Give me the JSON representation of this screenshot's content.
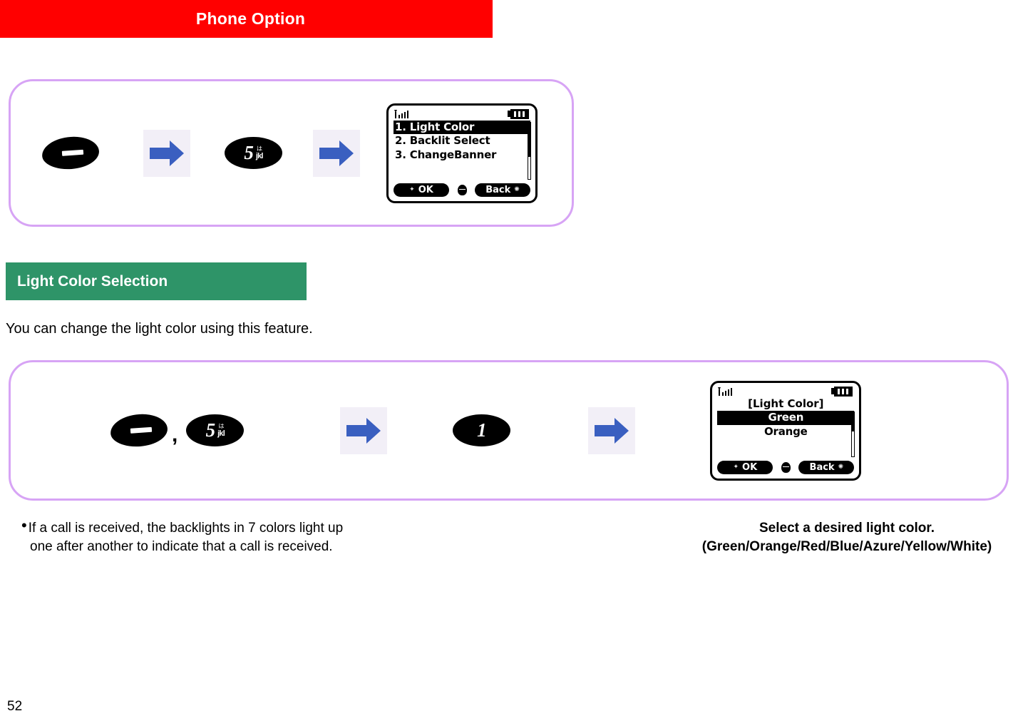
{
  "header": {
    "title": "Phone Option",
    "background_color": "#FF0000",
    "text_color": "#FFFFFF"
  },
  "section": {
    "title": "Light Color Selection",
    "background_color": "#2E9468",
    "text_color": "#FFFFFF"
  },
  "intro_text": "You can change the light color using this feature.",
  "flow_one": {
    "step_menu_key": {
      "icon": "menu-key-icon",
      "label": ""
    },
    "arrow_1": "right-arrow-icon",
    "step_number_key": {
      "digit": "5",
      "sub_jp": "は",
      "sub_alpha": "jkl"
    },
    "arrow_2": "right-arrow-icon",
    "phone_screen": {
      "status": {
        "signal": "signal-bars-icon",
        "battery": "battery-icon"
      },
      "items": [
        {
          "label": "1. Light Color",
          "selected": true
        },
        {
          "label": "2. Backlit Select",
          "selected": false
        },
        {
          "label": "3. ChangeBanner",
          "selected": false
        }
      ],
      "softkeys": {
        "left": "OK",
        "right": "Back"
      }
    }
  },
  "flow_two": {
    "step_menu_key": {
      "icon": "menu-key-icon"
    },
    "separator": ",",
    "step_number_key": {
      "digit": "5",
      "sub_jp": "は",
      "sub_alpha": "jkl"
    },
    "arrow_1": "right-arrow-icon",
    "step_one_key": {
      "digit": "1"
    },
    "arrow_2": "right-arrow-icon",
    "phone_screen": {
      "status": {
        "signal": "signal-bars-icon",
        "battery": "battery-icon"
      },
      "title": "[Light Color]",
      "items": [
        {
          "label": "Green",
          "selected": true
        },
        {
          "label": "Orange",
          "selected": false
        }
      ],
      "softkeys": {
        "left": "OK",
        "right": "Back"
      }
    }
  },
  "notes": {
    "bullet": "•",
    "line_1": "If a call is received, the backlights in 7 colors light up",
    "line_2": "one after another to indicate that a call is received."
  },
  "caption": {
    "line_1": "Select a desired light color.",
    "line_2": "(Green/Orange/Red/Blue/Azure/Yellow/White)"
  },
  "page_number": "52",
  "colors": {
    "flow_border": "#D7A4F5",
    "arrow_blue": "#3A5FC0",
    "arrow_bg": "#F2EFF7"
  }
}
